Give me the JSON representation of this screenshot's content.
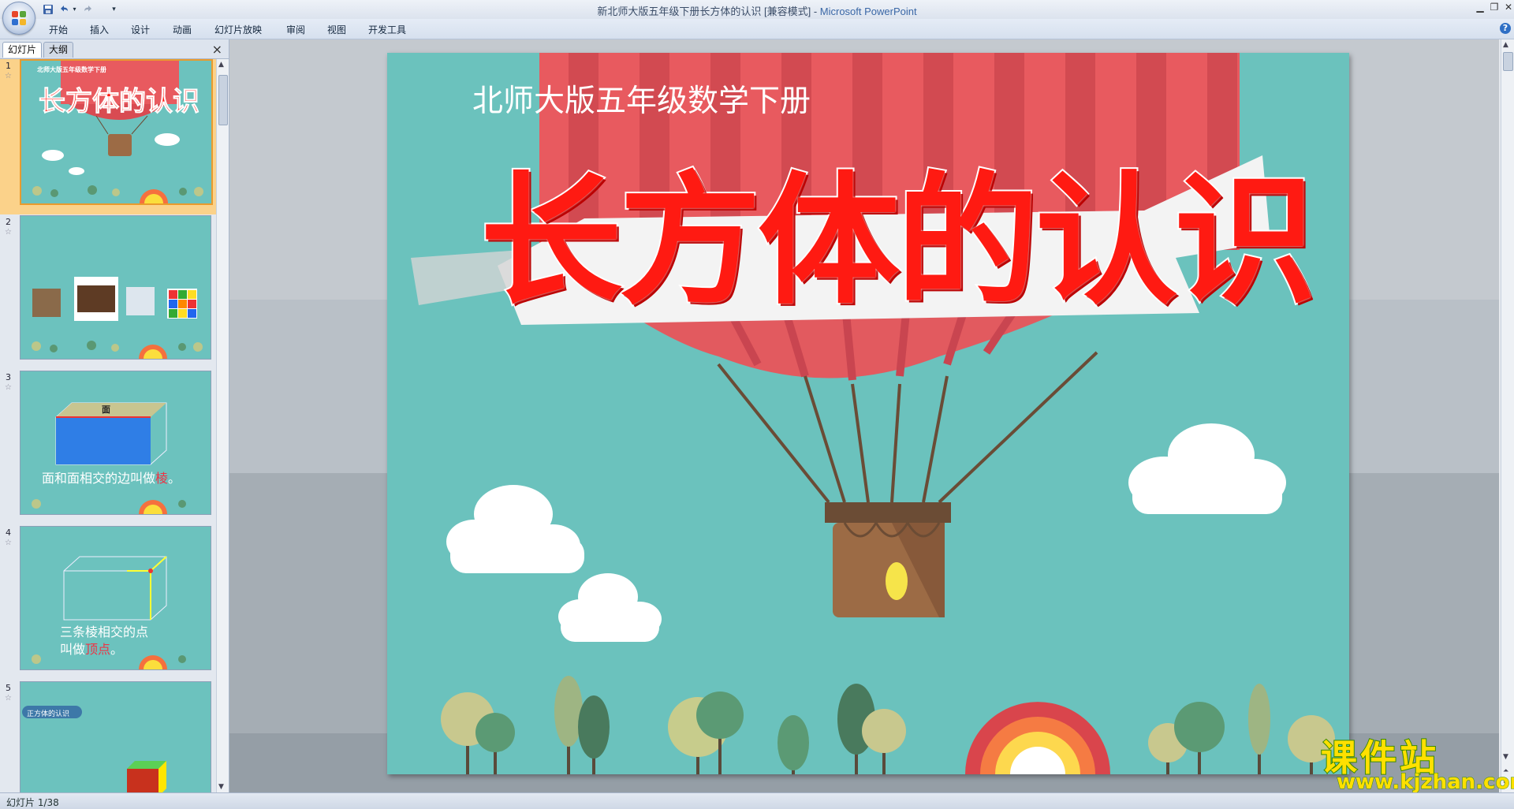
{
  "window": {
    "title": "新北师大版五年级下册长方体的认识 [兼容模式] - ",
    "app": "Microsoft PowerPoint"
  },
  "quick_access": [
    "save-icon",
    "undo-icon",
    "redo-icon",
    "customize-icon"
  ],
  "ribbon": {
    "tabs": [
      "开始",
      "插入",
      "设计",
      "动画",
      "幻灯片放映",
      "审阅",
      "视图",
      "开发工具"
    ]
  },
  "panel": {
    "tabs": [
      "幻灯片",
      "大纲"
    ],
    "close": "×"
  },
  "slides": [
    {
      "number": "1",
      "title": "长方体的认识",
      "subtitle": "北师大版五年级数学下册"
    },
    {
      "number": "2"
    },
    {
      "number": "3",
      "face_label": "面",
      "text_a": "面和面相交的边叫做",
      "text_b": "棱",
      "text_c": "。"
    },
    {
      "number": "4",
      "line1": "三条棱相交的点",
      "line2_a": "叫做",
      "line2_b": "顶点",
      "line2_c": "。"
    },
    {
      "number": "5",
      "tag": "正方体的认识"
    }
  ],
  "main_slide": {
    "subtitle": "北师大版五年级数学下册",
    "title": "长方体的认识"
  },
  "status": {
    "slide_count": "幻灯片 1/38"
  },
  "watermark": {
    "name": "课件站",
    "url": "www.kjzhan.com"
  },
  "colors": {
    "slide_bg": "#6bc2bd",
    "balloon_red": "#e85a5f",
    "title_red": "#ff1a12",
    "accent_orange": "#e99b2d"
  }
}
